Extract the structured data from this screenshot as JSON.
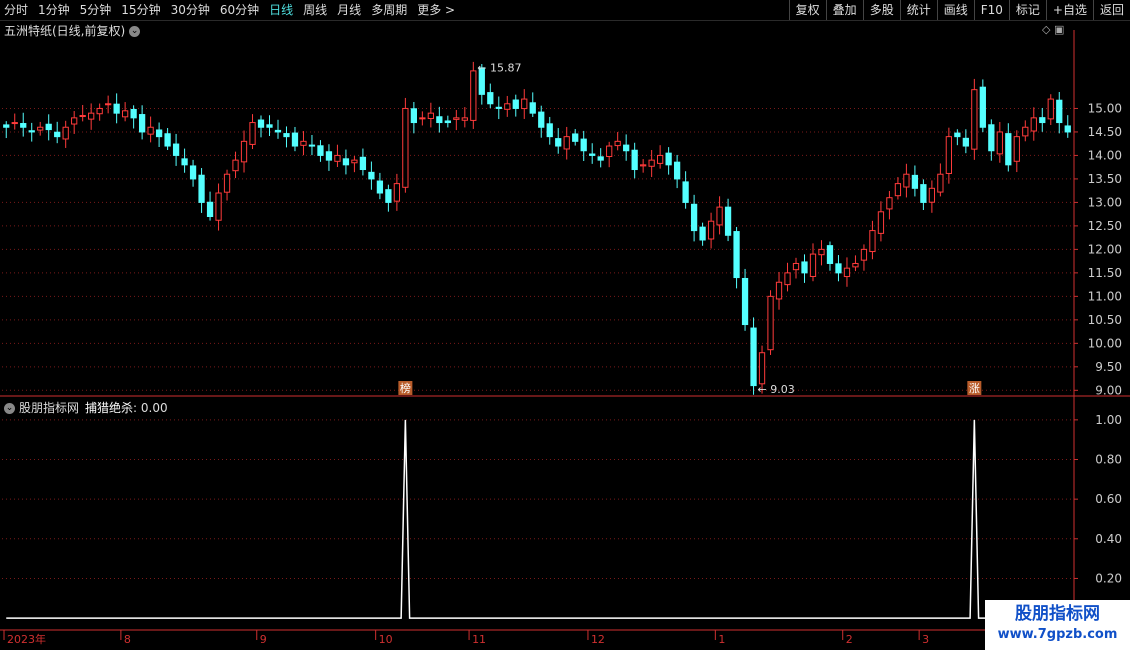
{
  "toolbar": {
    "left": [
      "分时",
      "1分钟",
      "5分钟",
      "15分钟",
      "30分钟",
      "60分钟",
      "日线",
      "周线",
      "月线",
      "多周期",
      "更多 >"
    ],
    "active": "日线",
    "right": [
      "复权",
      "叠加",
      "多股",
      "统计",
      "画线",
      "F10",
      "标记",
      "+自选",
      "返回"
    ]
  },
  "main_title": "五洲特纸(日线,前复权)",
  "indicator_title": "股朋指标网",
  "indicator_name": "捕猎绝杀",
  "indicator_value": ": 0.00",
  "badges": [
    "榜",
    "涨"
  ],
  "watermark": {
    "line1": "股朋指标网",
    "line2": "www.7gpzb.com"
  },
  "colors": {
    "up": "#ff3b3b",
    "down": "#54ffff",
    "grid": "#7a1a1a",
    "axis": "#d03030",
    "line": "#ffffff"
  },
  "chart_data": [
    {
      "type": "candlestick",
      "title": "",
      "y_ticks": [
        "15.00",
        "14.50",
        "14.00",
        "13.50",
        "13.00",
        "12.50",
        "12.00",
        "11.50",
        "11.00",
        "10.50",
        "10.00",
        "9.50",
        "9.00"
      ],
      "ylim": [
        8.9,
        16.5
      ],
      "x_ticks": [
        "2023年",
        "8",
        "9",
        "10",
        "11",
        "12",
        "1",
        "2",
        "3",
        "4"
      ],
      "annotations": [
        {
          "text": "15.87",
          "kind": "high"
        },
        {
          "text": "9.03",
          "kind": "low"
        }
      ],
      "close": [
        14.6,
        14.7,
        14.6,
        14.5,
        14.6,
        14.55,
        14.4,
        14.6,
        14.8,
        14.85,
        14.9,
        15.0,
        15.1,
        14.9,
        14.95,
        14.8,
        14.5,
        14.6,
        14.4,
        14.2,
        14.0,
        13.8,
        13.5,
        13.0,
        12.7,
        13.2,
        13.6,
        13.9,
        14.3,
        14.7,
        14.6,
        14.6,
        14.5,
        14.4,
        14.2,
        14.3,
        14.2,
        14.0,
        13.9,
        14.0,
        13.8,
        13.9,
        13.7,
        13.5,
        13.2,
        13.0,
        13.4,
        15.0,
        14.7,
        14.8,
        14.9,
        14.7,
        14.7,
        14.8,
        14.8,
        15.8,
        15.3,
        15.1,
        15.0,
        15.1,
        15.0,
        15.2,
        14.9,
        14.6,
        14.4,
        14.2,
        14.4,
        14.3,
        14.1,
        14.0,
        13.9,
        14.2,
        14.3,
        14.1,
        13.7,
        13.8,
        13.9,
        14.0,
        13.8,
        13.5,
        13.0,
        12.4,
        12.2,
        12.6,
        12.9,
        12.3,
        11.4,
        10.4,
        9.1,
        9.8,
        11.0,
        11.3,
        11.5,
        11.7,
        11.5,
        11.9,
        12.0,
        11.7,
        11.5,
        11.6,
        11.7,
        12.0,
        12.4,
        12.8,
        13.1,
        13.4,
        13.6,
        13.3,
        13.0,
        13.3,
        13.6,
        14.4,
        14.4,
        14.2,
        15.4,
        14.6,
        14.1,
        14.5,
        13.8,
        14.4,
        14.6,
        14.8,
        14.7,
        15.2,
        14.7,
        14.5
      ]
    },
    {
      "type": "line",
      "title": "",
      "y_ticks": [
        "1.00",
        "0.80",
        "0.60",
        "0.40",
        "0.20"
      ],
      "ylim": [
        -0.05,
        1.08
      ],
      "spikes": [
        {
          "index": 47,
          "value": 1.0
        },
        {
          "index": 114,
          "value": 1.0
        }
      ]
    }
  ]
}
